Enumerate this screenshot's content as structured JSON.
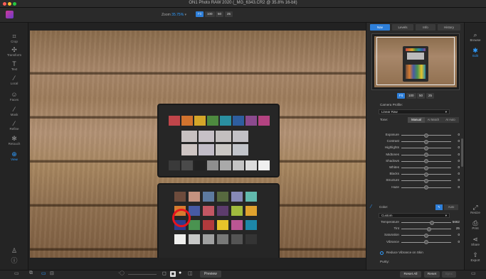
{
  "window": {
    "title": "ON1 Photo RAW 2020 (_MG_6343.CR2 @ 35.8% 16-bit)"
  },
  "toolbar": {
    "zoom_label": "Zoom",
    "zoom_value": "35.75",
    "zoom_unit": "%",
    "zoom_buttons": [
      "Fit",
      "100",
      "50",
      "25"
    ]
  },
  "left_tools": [
    {
      "label": "Crop",
      "icon": "crop-icon"
    },
    {
      "label": "Transform",
      "icon": "transform-icon"
    },
    {
      "label": "Text",
      "icon": "text-icon"
    },
    {
      "label": "Local",
      "icon": "local-brush-icon"
    },
    {
      "label": "Faces",
      "icon": "faces-icon"
    },
    {
      "label": "Mask",
      "icon": "mask-icon"
    },
    {
      "label": "Refine",
      "icon": "refine-icon"
    },
    {
      "label": "Retouch",
      "icon": "retouch-icon"
    },
    {
      "label": "View",
      "icon": "view-icon"
    }
  ],
  "panel": {
    "tabs": [
      "Nav",
      "Levels",
      "Info",
      "History"
    ],
    "active_tab": "Nav",
    "nav_zoom": [
      "Fit",
      "100",
      "50",
      "25"
    ],
    "camera_profile_label": "Camera Profile:",
    "camera_profile_value": "Linear Raw",
    "tone_label": "Tone:",
    "tone_modes": [
      "Manual",
      "AI Match",
      "AI Auto"
    ],
    "tone_sliders": [
      {
        "name": "Exposure",
        "value": "0",
        "pos": 0.5
      },
      {
        "name": "Contrast",
        "value": "0",
        "pos": 0.5
      },
      {
        "name": "Highlights",
        "value": "0",
        "pos": 0.5
      },
      {
        "name": "Midtones",
        "value": "0",
        "pos": 0.5
      },
      {
        "name": "Shadows",
        "value": "0",
        "pos": 0.5
      },
      {
        "name": "Whites",
        "value": "0",
        "pos": 0.5
      },
      {
        "name": "Blacks",
        "value": "0",
        "pos": 0.5
      },
      {
        "name": "Structure",
        "value": "0",
        "pos": 0.5
      },
      {
        "name": "Haze",
        "value": "0",
        "pos": 0.5
      }
    ],
    "color_label": "Color:",
    "color_auto": "Auto",
    "wb_preset": "Custom",
    "color_sliders": [
      {
        "name": "Temperature",
        "value": "5662",
        "pos": 0.62
      },
      {
        "name": "Tint",
        "value": "25",
        "pos": 0.56
      },
      {
        "name": "Saturation",
        "value": "0",
        "pos": 0.5
      },
      {
        "name": "Vibrance",
        "value": "0",
        "pos": 0.5
      }
    ],
    "reduce_vibrance_label": "Reduce Vibrance on Skin",
    "purity_label": "Purity:",
    "reset_all": "Reset All",
    "reset": "Reset",
    "sync": "Sync"
  },
  "right_tools": [
    {
      "label": "Browse",
      "icon": "browse-icon"
    },
    {
      "label": "Edit",
      "icon": "edit-icon"
    },
    {
      "label": "Resize",
      "icon": "resize-icon"
    },
    {
      "label": "Print",
      "icon": "print-icon"
    },
    {
      "label": "Share",
      "icon": "share-icon"
    },
    {
      "label": "Export",
      "icon": "export-icon"
    }
  ],
  "bottom": {
    "preview_label": "Preview"
  },
  "colors": {
    "accent": "#2e9cff",
    "highlight_circle": "#e8141c"
  }
}
